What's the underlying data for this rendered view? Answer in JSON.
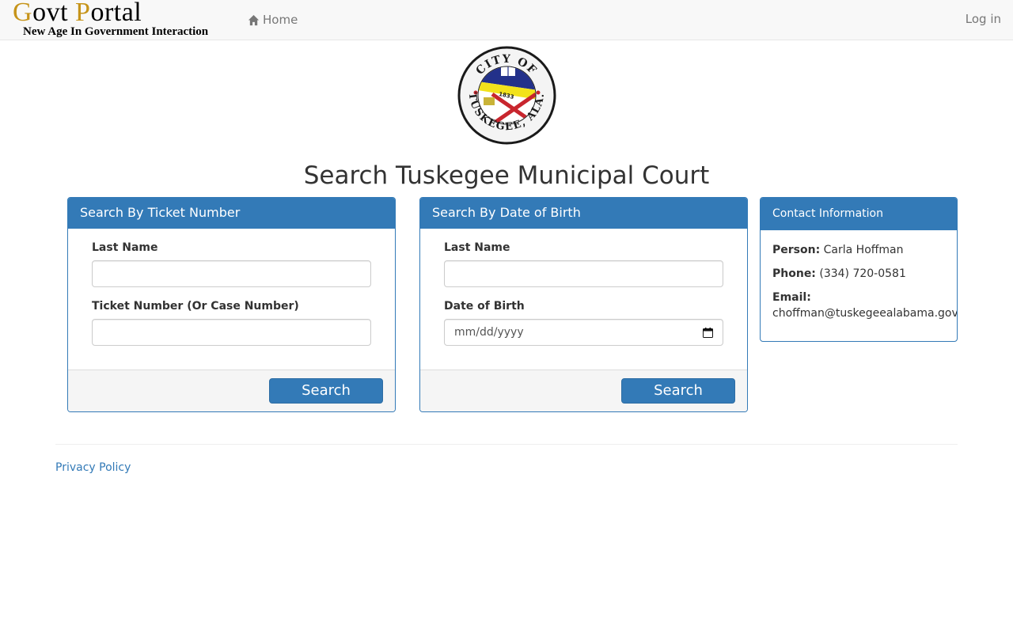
{
  "navbar": {
    "brand_title_first_cap": "G",
    "brand_title_part1": "ovt ",
    "brand_title_second_cap": "P",
    "brand_title_part2": "ortal",
    "brand_subtitle": "New Age In Government Interaction",
    "home_label": "Home",
    "login_label": "Log in"
  },
  "seal": {
    "top_text": "CITY OF",
    "bottom_text": "TUSKEGEE, ALA.",
    "year": "1833"
  },
  "page_title": "Search Tuskegee Municipal Court",
  "ticket_panel": {
    "heading": "Search By Ticket Number",
    "last_name_label": "Last Name",
    "last_name_value": "",
    "ticket_label": "Ticket Number (Or Case Number)",
    "ticket_value": "",
    "search_label": "Search"
  },
  "dob_panel": {
    "heading": "Search By Date of Birth",
    "last_name_label": "Last Name",
    "last_name_value": "",
    "dob_label": "Date of Birth",
    "dob_placeholder": "mm/dd/yyyy",
    "search_label": "Search"
  },
  "contact": {
    "heading": "Contact Information",
    "person_label": "Person:",
    "person_value": "Carla Hoffman",
    "phone_label": "Phone:",
    "phone_value": "(334) 720-0581",
    "email_label": "Email:",
    "email_value": "choffman@tuskegeealabama.gov"
  },
  "footer": {
    "privacy_label": "Privacy Policy"
  },
  "colors": {
    "primary": "#337ab7",
    "brand_gold": "#c6941a",
    "navbar_bg": "#f8f8f8"
  },
  "icons": {
    "home": "home-icon",
    "calendar": "calendar-icon",
    "seal": "city-seal-icon"
  }
}
